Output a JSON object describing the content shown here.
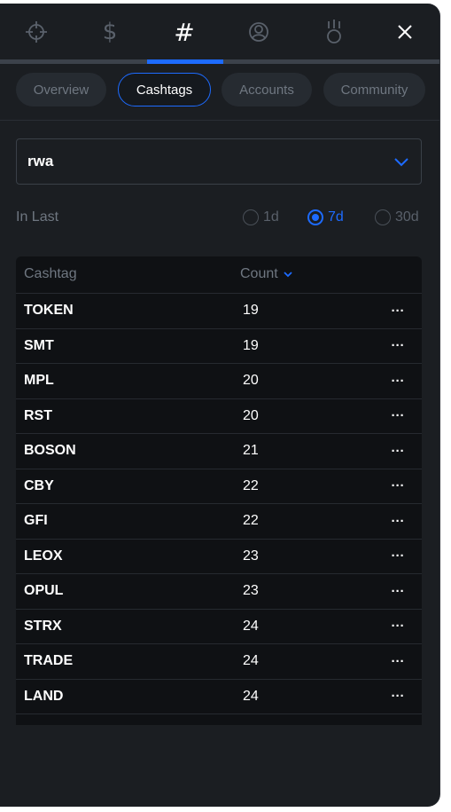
{
  "nav": {
    "icons": [
      "crosshair-icon",
      "dollar-icon",
      "hashtag-icon",
      "user-icon",
      "medal-icon",
      "close-icon"
    ],
    "active_index": 2,
    "hash_glyph": "#",
    "dollar_glyph": "$"
  },
  "tabs": [
    {
      "label": "Overview",
      "active": false
    },
    {
      "label": "Cashtags",
      "active": true
    },
    {
      "label": "Accounts",
      "active": false
    },
    {
      "label": "Community",
      "active": false
    }
  ],
  "filter": {
    "selected_value": "rwa",
    "period_label": "In Last",
    "periods": [
      {
        "label": "1d",
        "checked": false
      },
      {
        "label": "7d",
        "checked": true
      },
      {
        "label": "30d",
        "checked": false
      }
    ]
  },
  "table": {
    "headers": {
      "cashtag": "Cashtag",
      "count": "Count"
    },
    "more_glyph": "···",
    "rows": [
      {
        "cashtag": "TOKEN",
        "count": "19"
      },
      {
        "cashtag": "SMT",
        "count": "19"
      },
      {
        "cashtag": "MPL",
        "count": "20"
      },
      {
        "cashtag": "RST",
        "count": "20"
      },
      {
        "cashtag": "BOSON",
        "count": "21"
      },
      {
        "cashtag": "CBY",
        "count": "22"
      },
      {
        "cashtag": "GFI",
        "count": "22"
      },
      {
        "cashtag": "LEOX",
        "count": "23"
      },
      {
        "cashtag": "OPUL",
        "count": "23"
      },
      {
        "cashtag": "STRX",
        "count": "24"
      },
      {
        "cashtag": "TRADE",
        "count": "24"
      },
      {
        "cashtag": "LAND",
        "count": "24"
      }
    ]
  },
  "colors": {
    "accent": "#1d6bff",
    "panel_bg": "#1b1e22",
    "table_bg": "#0f1114",
    "muted_text": "#6f7781"
  }
}
